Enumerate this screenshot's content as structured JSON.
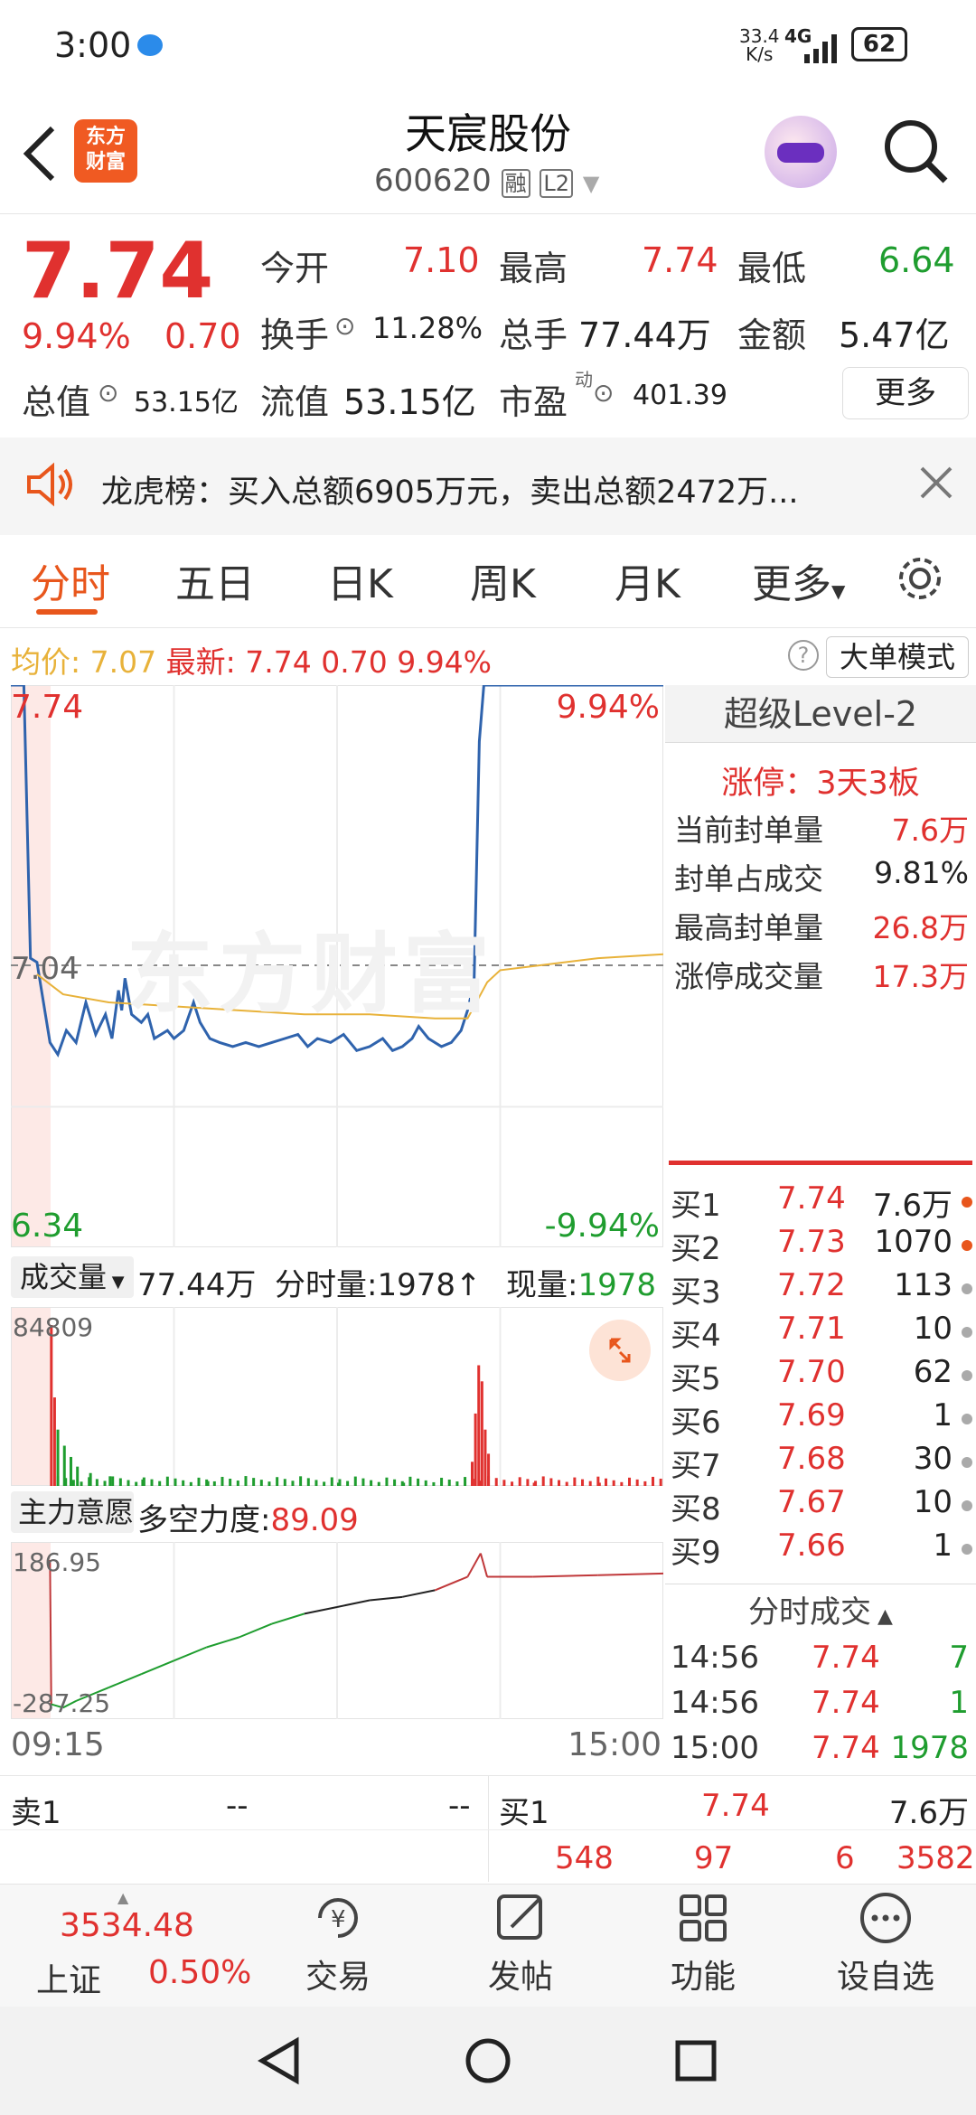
{
  "status_bar": {
    "time": "3:00",
    "net_speed_top": "33.4",
    "net_speed_bottom": "K/s",
    "network": "4G",
    "battery": "62"
  },
  "header": {
    "logo_line1": "东方",
    "logo_line2": "财富",
    "stock_name": "天宸股份",
    "stock_code": "600620",
    "badge_rong": "融",
    "badge_l2": "L2"
  },
  "quote": {
    "price": "7.74",
    "change_pct": "9.94%",
    "change": "0.70",
    "open_label": "今开",
    "open": "7.10",
    "high_label": "最高",
    "high": "7.74",
    "low_label": "最低",
    "low": "6.64",
    "turnover_label": "换手",
    "turnover": "11.28%",
    "volume_label": "总手",
    "volume": "77.44万",
    "amount_label": "金额",
    "amount": "5.47亿",
    "mktcap_label": "总值",
    "mktcap": "53.15亿",
    "float_label": "流值",
    "float_cap": "53.15亿",
    "pe_label": "市盈",
    "pe_sup": "动",
    "pe": "401.39",
    "more_button": "更多"
  },
  "notice": {
    "text": "龙虎榜：买入总额6905万元，卖出总额2472万..."
  },
  "tabs": [
    "分时",
    "五日",
    "日K",
    "周K",
    "月K",
    "更多"
  ],
  "active_tab": 0,
  "chart_info": {
    "avg_label": "均价:",
    "avg": "7.07",
    "latest_label": "最新:",
    "latest": "7.74",
    "change": "0.70",
    "change_pct": "9.94%",
    "mode_button": "大单模式"
  },
  "price_axis": {
    "top": "7.74",
    "mid": "7.04",
    "bottom": "6.34",
    "top_pct": "9.94%",
    "bottom_pct": "-9.94%"
  },
  "watermark": "东方财富",
  "level2": {
    "title": "超级Level-2",
    "limit_up": "涨停：3天3板",
    "rows": [
      {
        "label": "当前封单量",
        "value": "7.6万"
      },
      {
        "label": "封单占成交",
        "value": "9.81%"
      },
      {
        "label": "最高封单量",
        "value": "26.8万"
      },
      {
        "label": "涨停成交量",
        "value": "17.3万"
      }
    ]
  },
  "orderbook": [
    {
      "label": "买1",
      "price": "7.74",
      "qty": "7.6万",
      "dot": "#e8561c"
    },
    {
      "label": "买2",
      "price": "7.73",
      "qty": "1070",
      "dot": "#e8561c"
    },
    {
      "label": "买3",
      "price": "7.72",
      "qty": "113",
      "dot": "#aaaaaa"
    },
    {
      "label": "买4",
      "price": "7.71",
      "qty": "10",
      "dot": "#aaaaaa"
    },
    {
      "label": "买5",
      "price": "7.70",
      "qty": "62",
      "dot": "#aaaaaa"
    },
    {
      "label": "买6",
      "price": "7.69",
      "qty": "1",
      "dot": "#aaaaaa"
    },
    {
      "label": "买7",
      "price": "7.68",
      "qty": "30",
      "dot": "#aaaaaa"
    },
    {
      "label": "买8",
      "price": "7.67",
      "qty": "10",
      "dot": "#aaaaaa"
    },
    {
      "label": "买9",
      "price": "7.66",
      "qty": "1",
      "dot": "#aaaaaa"
    }
  ],
  "volume_panel": {
    "selector": "成交量",
    "total": "77.44万",
    "tick_label": "分时量:",
    "tick_value": "1978↑",
    "now_label": "现量:",
    "now_value": "1978",
    "max": "84809"
  },
  "ticks_title": "分时成交",
  "ticks": [
    {
      "time": "14:56",
      "price": "7.74",
      "vol": "7"
    },
    {
      "time": "14:56",
      "price": "7.74",
      "vol": "1"
    },
    {
      "time": "15:00",
      "price": "7.74",
      "vol": "1978"
    }
  ],
  "indicator_panel": {
    "selector": "主力意愿",
    "label": "多空力度:",
    "value": "89.09",
    "max": "186.95",
    "min": "-287.25"
  },
  "time_axis": {
    "start": "09:15",
    "end": "15:00"
  },
  "bottom_quote": {
    "sell_label": "卖1",
    "sell_price": "--",
    "sell_qty": "--",
    "buy_label": "买1",
    "buy_price": "7.74",
    "buy_qty": "7.6万",
    "counts": [
      "548",
      "97",
      "6",
      "3582"
    ]
  },
  "bottom_nav": {
    "index_value": "3534.48",
    "index_name": "上证",
    "index_pct": "0.50%",
    "items": [
      "交易",
      "发帖",
      "功能",
      "设自选"
    ]
  },
  "chart_data": {
    "type": "line",
    "title": "",
    "x_range": [
      "09:15",
      "15:00"
    ],
    "ylim": [
      6.34,
      7.74
    ],
    "prev_close": 7.04,
    "series": [
      {
        "color": "#2f63ad",
        "points": [
          [
            0,
            7.74
          ],
          [
            0.012,
            7.74
          ],
          [
            0.02,
            7.74
          ],
          [
            0.03,
            7.06
          ],
          [
            0.04,
            7.05
          ],
          [
            0.06,
            6.85
          ],
          [
            0.072,
            6.82
          ],
          [
            0.085,
            6.88
          ],
          [
            0.1,
            6.85
          ],
          [
            0.115,
            6.95
          ],
          [
            0.13,
            6.87
          ],
          [
            0.145,
            6.92
          ],
          [
            0.155,
            6.86
          ],
          [
            0.165,
            6.98
          ],
          [
            0.17,
            6.93
          ],
          [
            0.175,
            7.01
          ],
          [
            0.185,
            6.92
          ],
          [
            0.2,
            6.9
          ],
          [
            0.21,
            6.92
          ],
          [
            0.22,
            6.86
          ],
          [
            0.24,
            6.88
          ],
          [
            0.25,
            6.86
          ],
          [
            0.265,
            6.88
          ],
          [
            0.28,
            6.95
          ],
          [
            0.29,
            6.9
          ],
          [
            0.305,
            6.86
          ],
          [
            0.32,
            6.85
          ],
          [
            0.34,
            6.84
          ],
          [
            0.36,
            6.85
          ],
          [
            0.38,
            6.84
          ],
          [
            0.4,
            6.85
          ],
          [
            0.42,
            6.86
          ],
          [
            0.44,
            6.87
          ],
          [
            0.455,
            6.84
          ],
          [
            0.47,
            6.86
          ],
          [
            0.49,
            6.85
          ],
          [
            0.51,
            6.87
          ],
          [
            0.53,
            6.83
          ],
          [
            0.55,
            6.84
          ],
          [
            0.57,
            6.86
          ],
          [
            0.585,
            6.83
          ],
          [
            0.6,
            6.84
          ],
          [
            0.615,
            6.86
          ],
          [
            0.625,
            6.89
          ],
          [
            0.64,
            6.86
          ],
          [
            0.66,
            6.84
          ],
          [
            0.675,
            6.85
          ],
          [
            0.69,
            6.88
          ],
          [
            0.7,
            6.93
          ],
          [
            0.71,
            7.0
          ],
          [
            0.718,
            7.6
          ],
          [
            0.725,
            7.74
          ],
          [
            0.8,
            7.74
          ],
          [
            0.9,
            7.74
          ],
          [
            1.0,
            7.74
          ]
        ]
      },
      {
        "color": "#e8b23a",
        "points": [
          [
            0.04,
            7.02
          ],
          [
            0.08,
            6.97
          ],
          [
            0.15,
            6.95
          ],
          [
            0.25,
            6.94
          ],
          [
            0.35,
            6.93
          ],
          [
            0.45,
            6.92
          ],
          [
            0.55,
            6.92
          ],
          [
            0.65,
            6.91
          ],
          [
            0.7,
            6.91
          ],
          [
            0.73,
            7.0
          ],
          [
            0.75,
            7.03
          ],
          [
            0.8,
            7.04
          ],
          [
            0.9,
            7.06
          ],
          [
            1.0,
            7.07
          ]
        ]
      }
    ],
    "volume": {
      "max": 84809,
      "relative_bars": [
        [
          0.06,
          1.0
        ],
        [
          0.065,
          0.55
        ],
        [
          0.07,
          0.35
        ],
        [
          0.08,
          0.25
        ],
        [
          0.09,
          0.18
        ],
        [
          0.1,
          0.12
        ],
        [
          0.12,
          0.08
        ],
        [
          0.15,
          0.06
        ],
        [
          0.2,
          0.04
        ],
        [
          0.3,
          0.03
        ],
        [
          0.5,
          0.02
        ],
        [
          0.6,
          0.02
        ],
        [
          0.705,
          0.15
        ],
        [
          0.71,
          0.45
        ],
        [
          0.715,
          0.75
        ],
        [
          0.72,
          0.65
        ],
        [
          0.725,
          0.35
        ],
        [
          0.73,
          0.2
        ],
        [
          0.8,
          0.02
        ],
        [
          0.9,
          0.02
        ]
      ]
    },
    "indicator": {
      "max": 186.95,
      "min": -287.25,
      "points": [
        [
          0.06,
          160
        ],
        [
          0.062,
          -270
        ],
        [
          0.08,
          -280
        ],
        [
          0.1,
          -260
        ],
        [
          0.15,
          -220
        ],
        [
          0.2,
          -180
        ],
        [
          0.25,
          -140
        ],
        [
          0.3,
          -100
        ],
        [
          0.35,
          -70
        ],
        [
          0.4,
          -30
        ],
        [
          0.45,
          0
        ],
        [
          0.5,
          20
        ],
        [
          0.55,
          40
        ],
        [
          0.6,
          50
        ],
        [
          0.65,
          70
        ],
        [
          0.7,
          110
        ],
        [
          0.72,
          180
        ],
        [
          0.73,
          110
        ],
        [
          0.8,
          110
        ],
        [
          0.9,
          115
        ],
        [
          1.0,
          120
        ]
      ]
    }
  }
}
